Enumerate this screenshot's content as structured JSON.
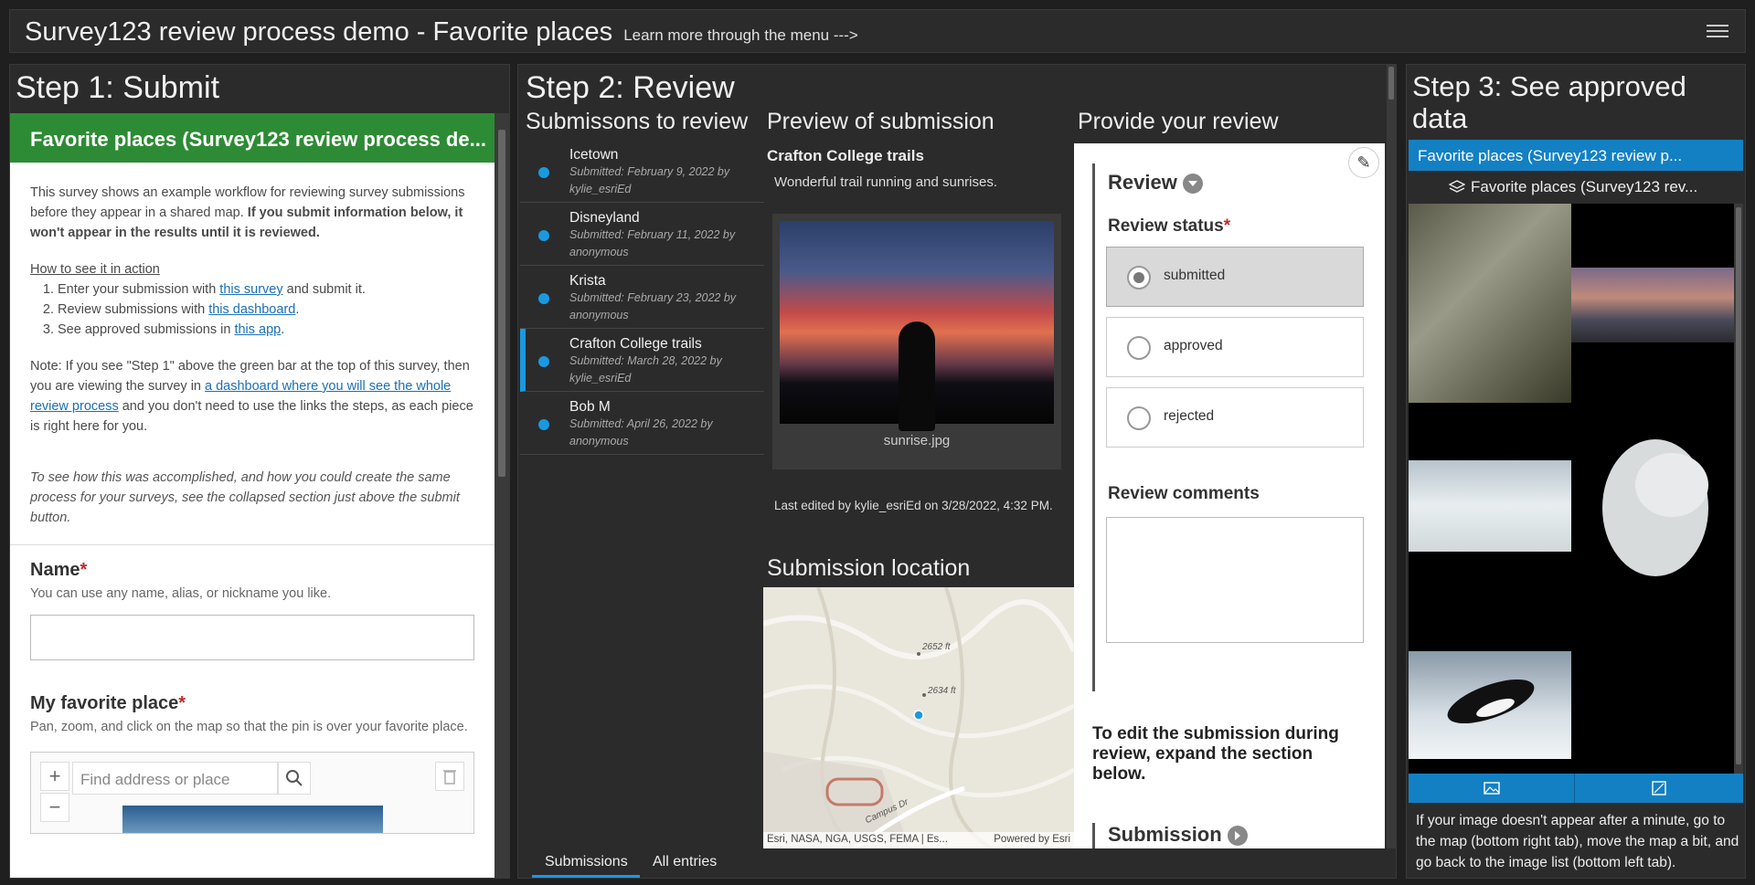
{
  "header": {
    "title": "Survey123 review process demo - Favorite places",
    "subtitle": "Learn more through the menu --->"
  },
  "step1": {
    "title": "Step 1: Submit",
    "form_header": "Favorite places (Survey123 review process de...",
    "intro": "This survey shows an example workflow for reviewing survey submissions before they appear in a shared map.",
    "intro_bold": "If you submit information below, it won't appear in the results until it is reviewed.",
    "how_title": "How to see it in action",
    "steps": [
      {
        "pre": "Enter your submission with ",
        "link": "this survey",
        "post": " and submit it."
      },
      {
        "pre": "Review submissions with ",
        "link": "this dashboard",
        "post": "."
      },
      {
        "pre": "See approved submissions in ",
        "link": "this app",
        "post": "."
      }
    ],
    "note_pre": "Note: If you see \"Step 1\" above the green bar at the top of this survey, then you are viewing the survey in ",
    "note_link": "a dashboard where you will see the whole review process",
    "note_post": " and you don't need to use the links the steps, as each piece is right here for you.",
    "italic_note": "To see how this was accomplished, and how you could create the same process for your surveys, see the collapsed section just above the submit button.",
    "name_label": "Name",
    "name_hint": "You can use any name, alias, or nickname you like.",
    "place_label": "My favorite place",
    "place_hint": "Pan, zoom, and click on the map so that the pin is over your favorite place.",
    "search_placeholder": "Find address or place"
  },
  "step2": {
    "title": "Step 2: Review",
    "list_title": "Submissons to review",
    "submissions": [
      {
        "name": "Icetown",
        "submitted": "Submitted: February 9, 2022 by",
        "by": "kylie_esriEd"
      },
      {
        "name": "Disneyland",
        "submitted": "Submitted: February 11, 2022 by",
        "by": "anonymous"
      },
      {
        "name": "Krista",
        "submitted": "Submitted: February 23, 2022 by",
        "by": "anonymous"
      },
      {
        "name": "Crafton College trails",
        "submitted": "Submitted: March 28, 2022 by",
        "by": "kylie_esriEd"
      },
      {
        "name": "Bob M",
        "submitted": "Submitted: April 26, 2022 by",
        "by": "anonymous"
      }
    ],
    "preview_title": "Preview of submission",
    "preview_name": "Crafton College trails",
    "preview_desc": "Wonderful trail running and sunrises.",
    "preview_file": "sunrise.jpg",
    "last_edited": "Last edited by kylie_esriEd on 3/28/2022, 4:32 PM.",
    "location_title": "Submission location",
    "map_labels": [
      "2652 ft",
      "2634 ft",
      "Campus Dr"
    ],
    "map_attr": "Esri, NASA, NGA, USGS, FEMA | Es...",
    "map_powered": "Powered by Esri",
    "review_title": "Provide your review",
    "review_group": "Review",
    "status_label": "Review status",
    "status_options": [
      "submitted",
      "approved",
      "rejected"
    ],
    "comments_label": "Review comments",
    "edit_note": "To edit the submission during review, expand the section below.",
    "submission_group": "Submission",
    "tabs": [
      "Submissions",
      "All entries"
    ]
  },
  "step3": {
    "title_line1": "Step 3: See approved",
    "title_line2": "data",
    "bar": "Favorite places (Survey123 review p...",
    "layer": "Favorite places (Survey123 rev...",
    "note": "If your image doesn't appear after a minute, go to the map (bottom right tab), move the map a bit, and go back to the image list (bottom left tab)."
  },
  "colors": {
    "form_header": "#2e8b35",
    "accent": "#1a99e0",
    "step3_bar": "#1380c4"
  }
}
